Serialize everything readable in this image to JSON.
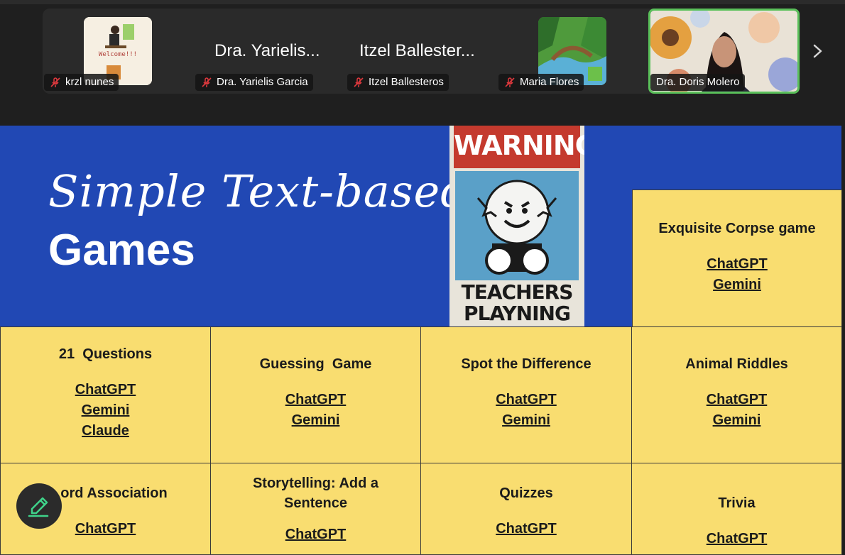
{
  "participants": [
    {
      "id": "krzl",
      "display_name": "",
      "name": "krzl nunes",
      "muted": true,
      "has_thumb": true
    },
    {
      "id": "yarielis",
      "display_name": "Dra. Yarielis...",
      "name": "Dra. Yarielis Garcia",
      "muted": true
    },
    {
      "id": "itzel",
      "display_name": "Itzel Ballester...",
      "name": "Itzel Ballesteros",
      "muted": true
    },
    {
      "id": "maria",
      "display_name": "",
      "name": "Maria Flores",
      "muted": true,
      "has_thumb": true
    },
    {
      "id": "doris",
      "display_name": "",
      "name": "Dra. Doris Molero",
      "muted": false,
      "active_speaker": true
    }
  ],
  "krzl_thumb_text": "Welcome!!!",
  "slide": {
    "title_line1": "Simple Text-based",
    "title_line2": "Games",
    "poster_top": "WARNING",
    "poster_bottom_1": "TEACHERS",
    "poster_bottom_2": "PLAYNING",
    "cells": [
      {
        "title": "Exquisite Corpse game",
        "links": [
          "ChatGPT",
          "Gemini"
        ]
      },
      {
        "title": "21  Questions",
        "links": [
          "ChatGPT",
          "Gemini",
          "Claude"
        ]
      },
      {
        "title": "Guessing  Game",
        "links": [
          "ChatGPT",
          "Gemini"
        ]
      },
      {
        "title": "Spot the Difference",
        "links": [
          "ChatGPT",
          "Gemini"
        ]
      },
      {
        "title": "Animal Riddles",
        "links": [
          "ChatGPT",
          "Gemini"
        ]
      },
      {
        "title": "ord Association",
        "links": [
          "ChatGPT"
        ]
      },
      {
        "title": "Storytelling: Add a Sentence",
        "links": [
          "ChatGPT"
        ]
      },
      {
        "title": "Quizzes",
        "links": [
          "ChatGPT"
        ]
      },
      {
        "title": "Trivia",
        "links": [
          "ChatGPT"
        ]
      }
    ]
  },
  "colors": {
    "banner": "#2148b4",
    "cell": "#f9dd70",
    "speaker_border": "#5ac05a",
    "muted_icon": "#e0393e"
  },
  "icons": {
    "mic_muted": "mic-muted-icon",
    "next": "chevron-right-icon",
    "annotate": "pencil-icon"
  }
}
